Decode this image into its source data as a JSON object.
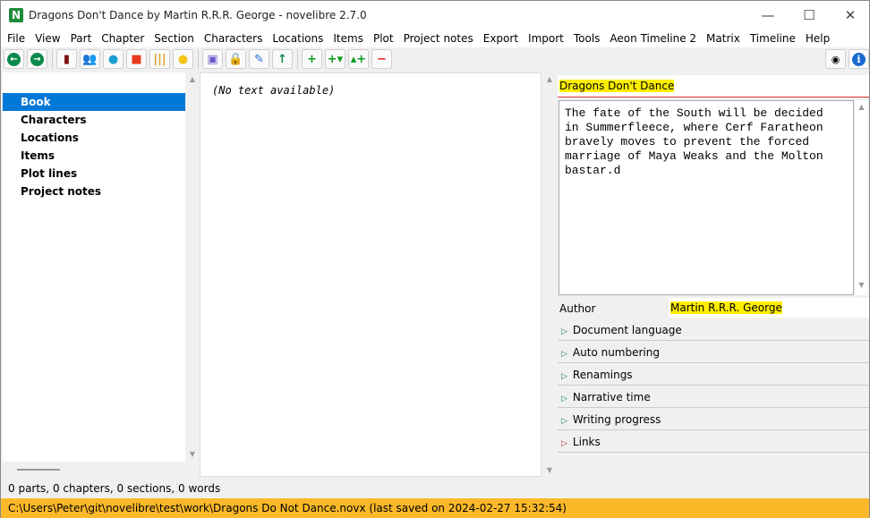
{
  "window": {
    "title": "Dragons Don't Dance by Martin R.R.R. George - novelibre 2.7.0",
    "app_icon": "N",
    "minimize": "—",
    "maximize": "☐",
    "close": "✕"
  },
  "menu": [
    "File",
    "View",
    "Part",
    "Chapter",
    "Section",
    "Characters",
    "Locations",
    "Items",
    "Plot",
    "Project notes",
    "Export",
    "Import",
    "Tools",
    "Aeon Timeline 2",
    "Matrix",
    "Timeline",
    "Help"
  ],
  "toolbar": [
    {
      "icon": "arrow-left-icon",
      "glyph": "←",
      "color": "#0a8a4a"
    },
    {
      "icon": "arrow-right-icon",
      "glyph": "→",
      "color": "#0a8a4a"
    },
    {
      "icon": "book-icon",
      "glyph": "▮",
      "color": "#7a0e0e"
    },
    {
      "icon": "characters-icon",
      "glyph": "👥",
      "color": "#3a6fd0"
    },
    {
      "icon": "globe-icon",
      "glyph": "●",
      "color": "#1aa0d0"
    },
    {
      "icon": "item-box-icon",
      "glyph": "■",
      "color": "#e83a1a"
    },
    {
      "icon": "plot-lines-icon",
      "glyph": "|||",
      "color": "#e0a020"
    },
    {
      "icon": "lightbulb-icon",
      "glyph": "●",
      "color": "#f5c518"
    },
    {
      "icon": "save-icon",
      "glyph": "▣",
      "color": "#6a5acd"
    },
    {
      "icon": "lock-icon",
      "glyph": "🔒",
      "color": "#f08c00"
    },
    {
      "icon": "edit-pen-icon",
      "glyph": "✎",
      "color": "#1a6ad0"
    },
    {
      "icon": "export-upload-icon",
      "glyph": "↑",
      "color": "#0a8a4a"
    },
    {
      "icon": "add-icon",
      "glyph": "+",
      "color": "#0a9a1a"
    },
    {
      "icon": "add-child-icon",
      "glyph": "+▾",
      "color": "#0a9a1a"
    },
    {
      "icon": "add-parent-icon",
      "glyph": "▴+",
      "color": "#0a9a1a"
    },
    {
      "icon": "remove-icon",
      "glyph": "−",
      "color": "#e02020"
    }
  ],
  "toolbar_right": [
    {
      "icon": "eye-icon",
      "glyph": "👁"
    },
    {
      "icon": "info-icon",
      "glyph": "i"
    }
  ],
  "tree": {
    "items": [
      "Book",
      "Characters",
      "Locations",
      "Items",
      "Plot lines",
      "Project notes"
    ],
    "selected": "Book"
  },
  "editor": {
    "text": "(No text available)"
  },
  "properties": {
    "title": "Dragons Don't Dance",
    "description": "The fate of the South will be decided\nin Summerfleece, where Cerf Faratheon\nbravely moves to prevent the forced\nmarriage of Maya Weaks and the Molton\nbastar.d",
    "author_label": "Author",
    "author": "Martin R.R.R. George",
    "sections": [
      "Document language",
      "Auto numbering",
      "Renamings",
      "Narrative time",
      "Writing progress",
      "Links"
    ]
  },
  "status": "0 parts, 0 chapters, 0 sections, 0 words",
  "path_bar": "C:\\Users\\Peter\\git\\novelibre\\test\\work\\Dragons Do Not Dance.novx (last saved on 2024-02-27 15:32:54)",
  "colors": {
    "selection": "#0078d7",
    "path_bar": "#fbb929",
    "highlight": "#ffee00"
  }
}
